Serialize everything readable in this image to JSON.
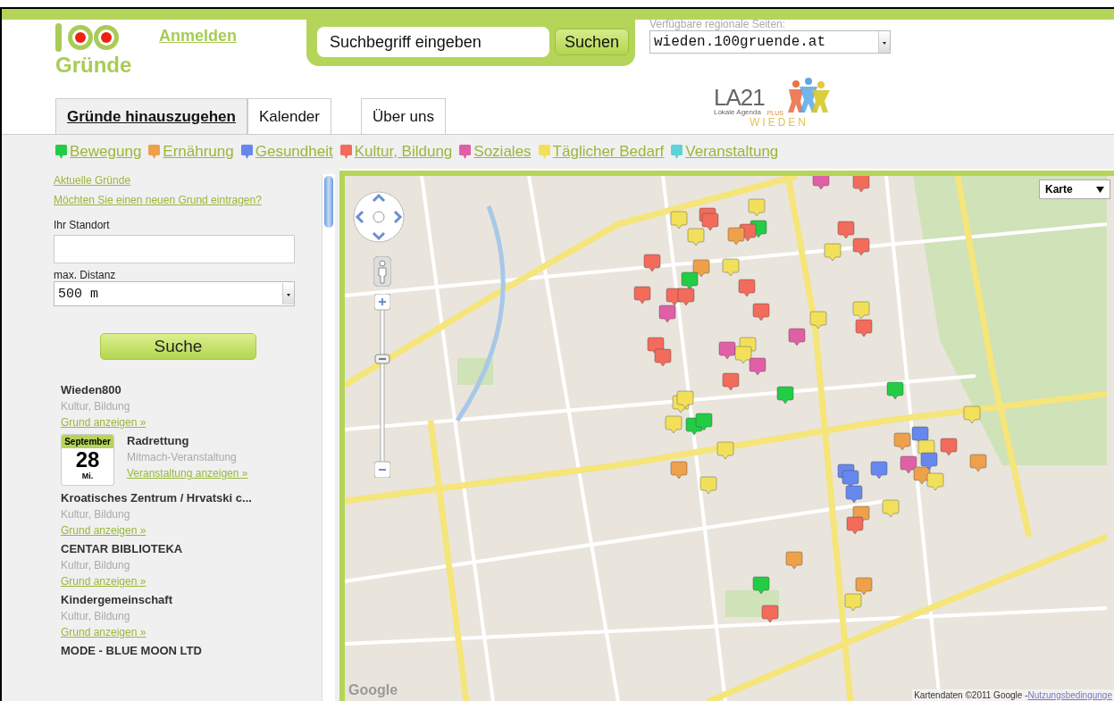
{
  "header": {
    "logo_text": "Gründe",
    "login_link": "Anmelden",
    "search": {
      "placeholder": "Suchbegriff eingeben",
      "button": "Suchen"
    },
    "region": {
      "label": "Verfügbare regionale Seiten:",
      "value": "wieden.100gruende.at"
    },
    "partner_logo": {
      "title": "LA21",
      "badge": "PLUS",
      "subtitle": "Lokale Agenda",
      "district": "WIEDEN"
    }
  },
  "tabs": [
    {
      "label": "Gründe hinauszugehen",
      "selected": true
    },
    {
      "label": "Kalender",
      "selected": false
    },
    {
      "label": "Über uns",
      "selected": false
    }
  ],
  "categories": [
    {
      "label": "Bewegung",
      "color": "#22cc44"
    },
    {
      "label": "Ernährung",
      "color": "#eea04a"
    },
    {
      "label": "Gesundheit",
      "color": "#6688ee"
    },
    {
      "label": "Kultur, Bildung",
      "color": "#f26b5b"
    },
    {
      "label": "Soziales",
      "color": "#e060a8"
    },
    {
      "label": "Täglicher Bedarf",
      "color": "#f2e05a"
    },
    {
      "label": "Veranstaltung",
      "color": "#5fd3d8"
    }
  ],
  "sidebar": {
    "links": [
      "Aktuelle Gründe",
      "Möchten Sie einen neuen Grund eintragen?"
    ],
    "location": {
      "label": "Ihr Standort"
    },
    "distance": {
      "label": "max. Distanz",
      "value": "500 m"
    },
    "search_button": "Suche",
    "results": [
      {
        "kind": "place",
        "title": "Wieden800",
        "category": "Kultur, Bildung",
        "link": "Grund anzeigen »"
      },
      {
        "kind": "event",
        "month": "September",
        "day": "28",
        "weekday": "Mi.",
        "title": "Radrettung",
        "category": "Mitmach-Veranstaltung",
        "link": "Veranstaltung anzeigen »"
      },
      {
        "kind": "place",
        "title": "Kroatisches Zentrum / Hrvatski c...",
        "category": "Kultur, Bildung",
        "link": "Grund anzeigen »"
      },
      {
        "kind": "place",
        "title": "CENTAR BIBLIOTEKA",
        "category": "Kultur, Bildung",
        "link": "Grund anzeigen »"
      },
      {
        "kind": "place",
        "title": "Kindergemeinschaft",
        "category": "Kultur, Bildung",
        "link": "Grund anzeigen »"
      },
      {
        "kind": "place",
        "title": "MODE - BLUE MOON LTD"
      }
    ]
  },
  "map": {
    "type_control": "Karte",
    "zoom": {
      "level": 0.7
    },
    "logo": "Google",
    "attribution": "Kartendaten ©2011 Google - ",
    "terms_link": "Nutzungsbedingunge"
  }
}
